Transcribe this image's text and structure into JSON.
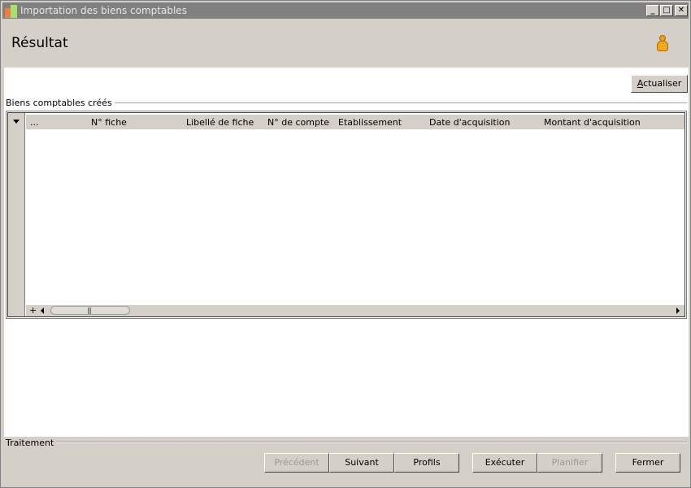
{
  "window": {
    "title": "Importation des biens comptables",
    "minimize_glyph": "_",
    "maximize_glyph": "□",
    "close_glyph": "✕"
  },
  "header": {
    "title": "Résultat",
    "user_icon": "user-icon"
  },
  "toolbar": {
    "refresh_mnemonic": "A",
    "refresh_rest": "ctualiser"
  },
  "section": {
    "label": "Biens comptables créés"
  },
  "grid": {
    "columns": [
      "...",
      "N° fiche",
      "Libellé de fiche",
      "N° de compte",
      "Etablissement",
      "Date d'acquisition",
      "Montant d'acquisition"
    ],
    "rows": [],
    "add_row_glyph": "+",
    "scroll_thumb_grip": "|||"
  },
  "footer": {
    "label": "Traitement",
    "buttons": {
      "previous": "Précédent",
      "next": "Suivant",
      "profiles": "Profils",
      "execute": "Exécuter",
      "schedule": "Planifier",
      "close": "Fermer"
    }
  }
}
